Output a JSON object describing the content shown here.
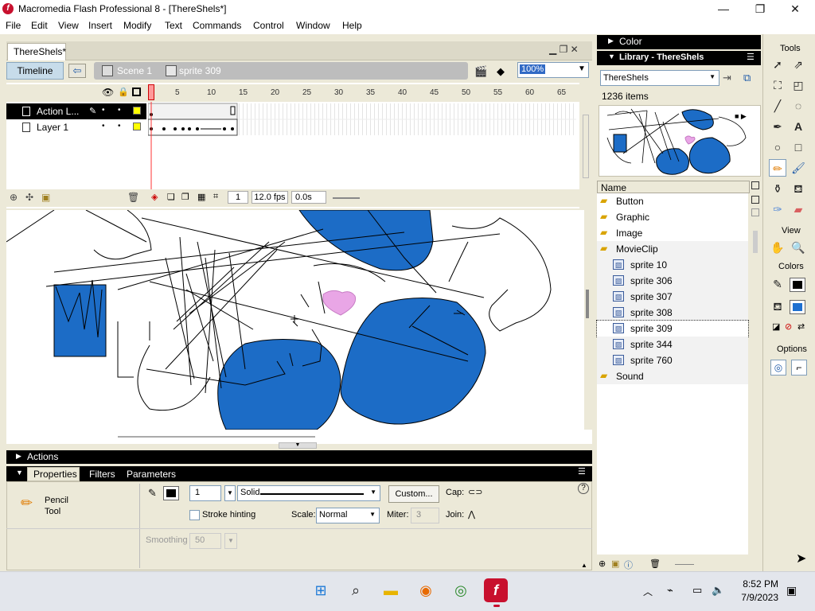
{
  "app": {
    "title": "Macromedia Flash Professional 8 - [ThereShels*]",
    "icon": "flash-icon"
  },
  "window_controls": {
    "minimize": "—",
    "maximize": "❐",
    "close": "✕"
  },
  "menu": [
    "File",
    "Edit",
    "View",
    "Insert",
    "Modify",
    "Text",
    "Commands",
    "Control",
    "Window",
    "Help"
  ],
  "document": {
    "tab": "ThereShels*",
    "timeline_button": "Timeline",
    "scene": "Scene 1",
    "symbol": "sprite 309",
    "zoom": "100%"
  },
  "timeline": {
    "frame_numbers": [
      "1",
      "5",
      "10",
      "15",
      "20",
      "25",
      "30",
      "35",
      "40",
      "45",
      "50",
      "55",
      "60",
      "65"
    ],
    "layers": [
      {
        "name": "Action L...",
        "selected": true
      },
      {
        "name": "Layer 1",
        "selected": false
      }
    ],
    "current_frame": "1",
    "fps": "12.0 fps",
    "time": "0.0s"
  },
  "panels": {
    "actions": "Actions",
    "properties_tabs": [
      "Properties",
      "Filters",
      "Parameters"
    ]
  },
  "properties": {
    "tool_name_line1": "Pencil",
    "tool_name_line2": "Tool",
    "stroke_width": "1",
    "stroke_style": "Solid",
    "custom_button": "Custom...",
    "cap_label": "Cap:",
    "stroke_hinting": "Stroke hinting",
    "scale_label": "Scale:",
    "scale_value": "Normal",
    "miter_label": "Miter:",
    "miter_value": "3",
    "join_label": "Join:",
    "smoothing_label": "Smoothing",
    "smoothing_value": "50",
    "help_icon": "?"
  },
  "library": {
    "color_panel": "Color",
    "title": "Library - ThereShels",
    "document": "ThereSheIs",
    "count": "1236 items",
    "name_header": "Name",
    "items": [
      {
        "name": "Button",
        "type": "folder"
      },
      {
        "name": "Graphic",
        "type": "folder"
      },
      {
        "name": "Image",
        "type": "folder"
      },
      {
        "name": "MovieClip",
        "type": "folder-open"
      },
      {
        "name": "sprite 10",
        "type": "movieclip"
      },
      {
        "name": "sprite 306",
        "type": "movieclip"
      },
      {
        "name": "sprite 307",
        "type": "movieclip"
      },
      {
        "name": "sprite 308",
        "type": "movieclip"
      },
      {
        "name": "sprite 309",
        "type": "movieclip"
      },
      {
        "name": "sprite 344",
        "type": "movieclip"
      },
      {
        "name": "sprite 760",
        "type": "movieclip"
      },
      {
        "name": "Sound",
        "type": "folder"
      }
    ]
  },
  "tools": {
    "title": "Tools",
    "view_label": "View",
    "colors_label": "Colors",
    "options_label": "Options",
    "stroke_color": "#000000",
    "fill_color": "#1e6fd0"
  },
  "taskbar": {
    "time": "8:52 PM",
    "date": "7/9/2023"
  },
  "colors": {
    "shape_blue": "#1c6cc6",
    "heart_pink": "#e9a6e6"
  }
}
